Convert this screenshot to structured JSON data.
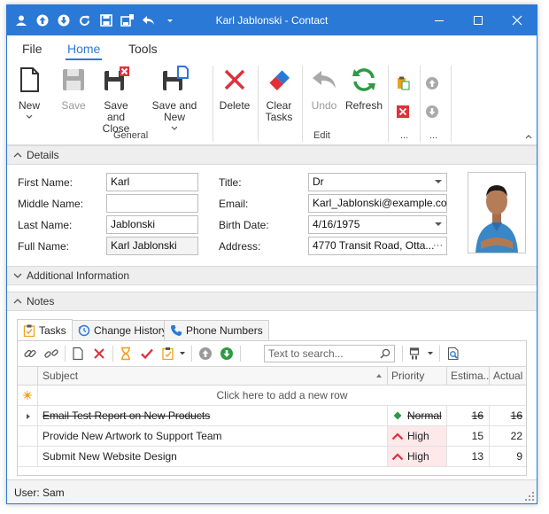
{
  "window": {
    "title": "Karl Jablonski - Contact"
  },
  "ribbon": {
    "tabs": [
      "File",
      "Home",
      "Tools"
    ],
    "active_tab": "Home",
    "buttons": {
      "new": "New",
      "save": "Save",
      "save_close_1": "Save and",
      "save_close_2": "Close",
      "save_new": "Save and New",
      "delete": "Delete",
      "clear_tasks_1": "Clear",
      "clear_tasks_2": "Tasks",
      "undo": "Undo",
      "refresh": "Refresh"
    },
    "groups": {
      "general": "General",
      "edit": "Edit",
      "more1": "...",
      "more2": "..."
    }
  },
  "details": {
    "header": "Details",
    "labels": {
      "first_name": "First Name:",
      "middle_name": "Middle Name:",
      "last_name": "Last Name:",
      "full_name": "Full Name:",
      "title": "Title:",
      "email": "Email:",
      "birth_date": "Birth Date:",
      "address": "Address:"
    },
    "values": {
      "first_name": "Karl",
      "middle_name": "",
      "last_name": "Jablonski",
      "full_name": "Karl Jablonski",
      "title": "Dr",
      "email": "Karl_Jablonski@example.com",
      "birth_date": "4/16/1975",
      "address": "4770 Transit Road, Otta..."
    }
  },
  "additional": {
    "header": "Additional Information"
  },
  "notes": {
    "header": "Notes",
    "tabs": [
      "Tasks",
      "Change History",
      "Phone Numbers"
    ],
    "search_placeholder": "Text to search...",
    "columns": [
      "Subject",
      "Priority",
      "Estima...",
      "Actual ..."
    ],
    "new_row_text": "Click here to add a new row",
    "rows": [
      {
        "subject": "Email Test Report on New Products",
        "priority": "Normal",
        "estimate": "16",
        "actual": "16",
        "done": true
      },
      {
        "subject": "Provide New Artwork to Support Team",
        "priority": "High",
        "estimate": "15",
        "actual": "22",
        "done": false
      },
      {
        "subject": "Submit New Website Design",
        "priority": "High",
        "estimate": "13",
        "actual": "9",
        "done": false
      }
    ]
  },
  "status": {
    "user": "User: Sam"
  },
  "colors": {
    "accent": "#2b79d7",
    "high_priority_bg": "#fde8ea",
    "high_priority_icon": "#e0303a",
    "normal_priority_icon": "#2e9a45"
  }
}
